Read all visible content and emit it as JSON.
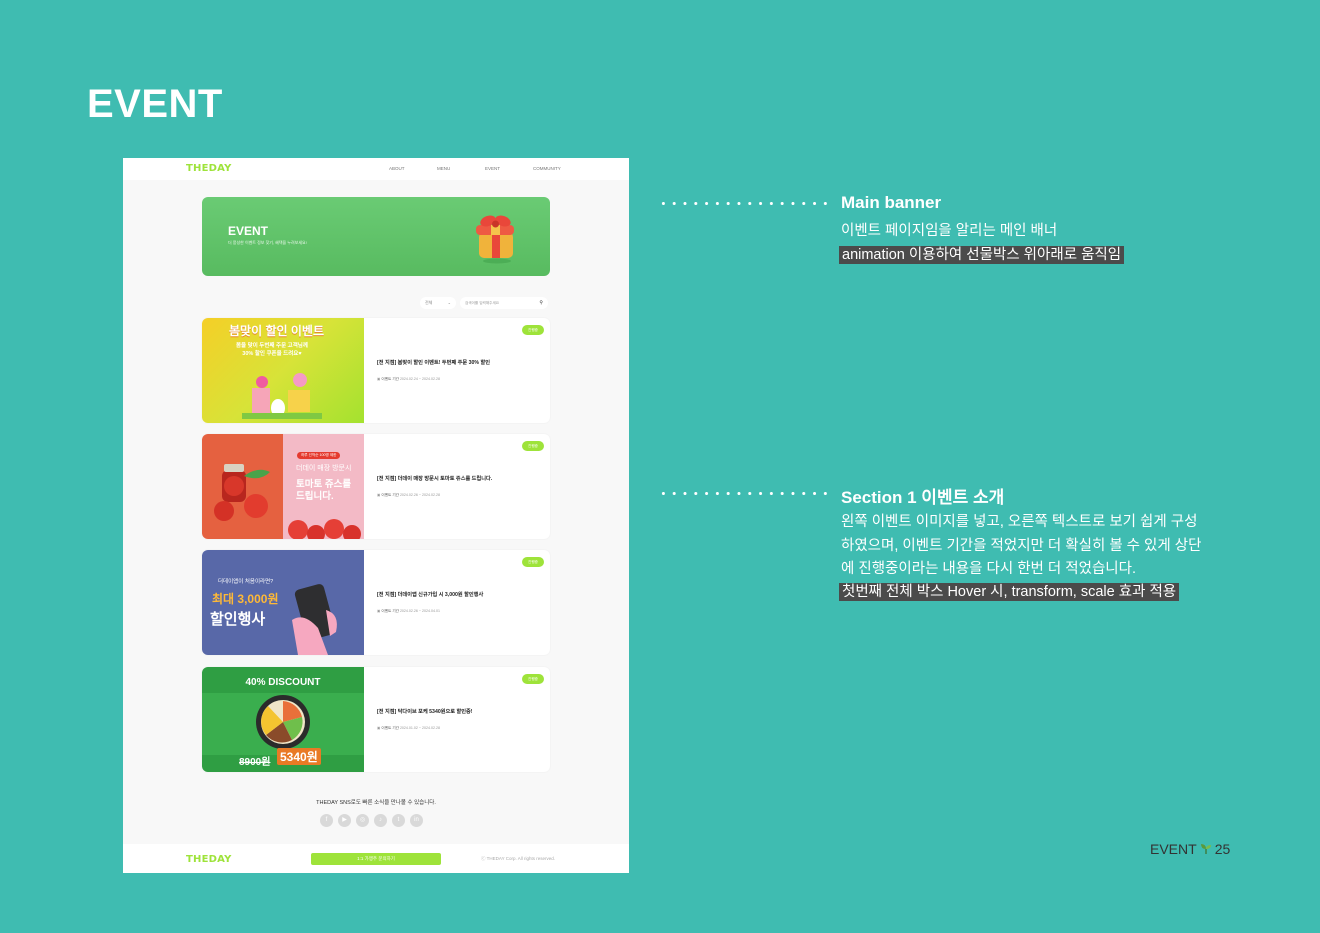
{
  "page_title": "EVENT",
  "mockup": {
    "nav": {
      "logo": "THEDAY",
      "menu": [
        "ABOUT",
        "MENU",
        "EVENT",
        "COMMUNITY"
      ]
    },
    "banner": {
      "title": "EVENT",
      "subtitle": "더 풍성한 이벤트 정보 찾기, 혜택을 누려보세요!"
    },
    "search": {
      "select_value": "전체",
      "placeholder": "검색어를 입력해주세요"
    },
    "cards": [
      {
        "image_text": {
          "headline": "봄맞이 할인 이벤트",
          "line1": "봄을 맞이 두번째 주문 고객님께",
          "line2": "30% 할인 쿠폰을 드려요♥"
        },
        "badge": "진행중",
        "title": "[전 지점] 봄맞이 할인 이벤트! 두번째 주문 30% 할인",
        "date_label": "이벤트 기간",
        "date": "2024.02.24 ~ 2024.02.28"
      },
      {
        "image_text": {
          "pill": "하루 선착순 100명 제한",
          "line1": "더데이 매장 방문시",
          "line2": "토마토 쥬스를",
          "line3": "드립니다."
        },
        "badge": "진행중",
        "title": "[전 지점] 더데이 매장 방문시 토마토 쥬스를 드립니다.",
        "date_label": "이벤트 기간",
        "date": "2024.02.26 ~ 2024.02.28"
      },
      {
        "image_text": {
          "line1": "더데이앱이 처음이라면?",
          "line2": "최대 3,000원",
          "line3": "할인행사"
        },
        "badge": "진행중",
        "title": "[전 지점] 더데이앱 신규가입 시 3,000원 할인행사",
        "date_label": "이벤트 기간",
        "date": "2024.02.26 ~ 2024.04.01"
      },
      {
        "image_text": {
          "headline": "40% DISCOUNT",
          "old_price": "8900원",
          "new_price": "5340원"
        },
        "badge": "진행중",
        "title": "[전 지점] 닥다이브 포케 5340원으로 할인중!",
        "date_label": "이벤트 기간",
        "date": "2024.01.02 ~ 2024.02.28"
      }
    ],
    "sns_text": "THEDAY SNS로도 빠른 소식을 만나볼 수 있습니다.",
    "sns_icons": [
      "facebook-icon",
      "youtube-icon",
      "instagram-icon",
      "tiktok-icon",
      "twitter-icon",
      "linkedin-icon"
    ],
    "footer": {
      "logo": "THEDAY",
      "inquiry_button": "1:1 가맹주 문의하기",
      "copyright": "ⓒ THEDAY Corp. All rights reserved."
    }
  },
  "annotations": [
    {
      "title": "Main banner",
      "lines": [
        "이벤트 페이지임을 알리는 메인 배너"
      ],
      "highlight": "animation 이용하여 선물박스 위아래로 움직임"
    },
    {
      "title": "Section 1 이벤트 소개",
      "lines": [
        "왼쪽 이벤트 이미지를 넣고, 오른쪽 텍스트로 보기 쉽게 구성",
        "하였으며, 이벤트 기간을 적었지만 더 확실히 볼 수 있게 상단",
        "에 진행중이라는 내용을 다시 한번 더 적었습니다."
      ],
      "highlight": "첫번째 전체 박스 Hover 시, transform, scale 효과 적용"
    }
  ],
  "page_number": {
    "label": "EVENT",
    "number": "25"
  },
  "colors": {
    "background": "#3fbcb1",
    "accent": "#9ee33a",
    "highlight_bg": "#4b4b4b"
  }
}
